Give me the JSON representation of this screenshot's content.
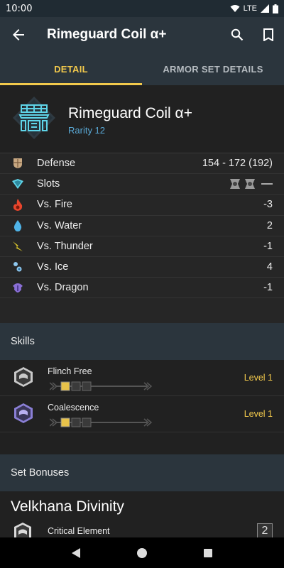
{
  "status": {
    "time": "10:00",
    "network": "LTE"
  },
  "appbar": {
    "title": "Rimeguard Coil α+",
    "back_icon": "arrow-back-icon",
    "search_icon": "search-icon",
    "bookmark_icon": "bookmark-icon"
  },
  "tabs": [
    {
      "label": "DETAIL",
      "active": true
    },
    {
      "label": "ARMOR SET DETAILS",
      "active": false
    }
  ],
  "armor": {
    "name": "Rimeguard Coil α+",
    "rarity": "Rarity 12",
    "icon": "waist-armor-icon",
    "icon_color": "#5fd4e8"
  },
  "stats": [
    {
      "label": "Defense",
      "value": "154 - 172 (192)",
      "icon": "defense-icon",
      "color": "#c8a882"
    },
    {
      "label": "Slots",
      "value": "",
      "icon": "slots-icon",
      "color": "#5fd4e8"
    },
    {
      "label": "Vs. Fire",
      "value": "-3",
      "icon": "fire-icon",
      "color": "#e8452c"
    },
    {
      "label": "Vs. Water",
      "value": "2",
      "icon": "water-icon",
      "color": "#4fb3e8"
    },
    {
      "label": "Vs. Thunder",
      "value": "-1",
      "icon": "thunder-icon",
      "color": "#e8d22c"
    },
    {
      "label": "Vs. Ice",
      "value": "4",
      "icon": "ice-icon",
      "color": "#8fc8f0"
    },
    {
      "label": "Vs. Dragon",
      "value": "-1",
      "icon": "dragon-icon",
      "color": "#8a6fd6"
    }
  ],
  "skills_section": {
    "title": "Skills"
  },
  "skills": [
    {
      "name": "Flinch Free",
      "level": "Level 1",
      "icon": "skill-gray-icon",
      "color": "#c9c9c9",
      "filled": 1,
      "max": 3
    },
    {
      "name": "Coalescence",
      "level": "Level 1",
      "icon": "skill-purple-icon",
      "color": "#8a7fd6",
      "filled": 1,
      "max": 3
    }
  ],
  "setbonus_section": {
    "title": "Set Bonuses"
  },
  "set_bonus": {
    "name": "Velkhana Divinity",
    "skill": "Critical Element",
    "pieces": "2",
    "icon": "skill-white-icon"
  },
  "colors": {
    "accent": "#f2c94c",
    "appbar": "#2b353d",
    "background": "#212121",
    "rarity": "#5aa9d6"
  }
}
